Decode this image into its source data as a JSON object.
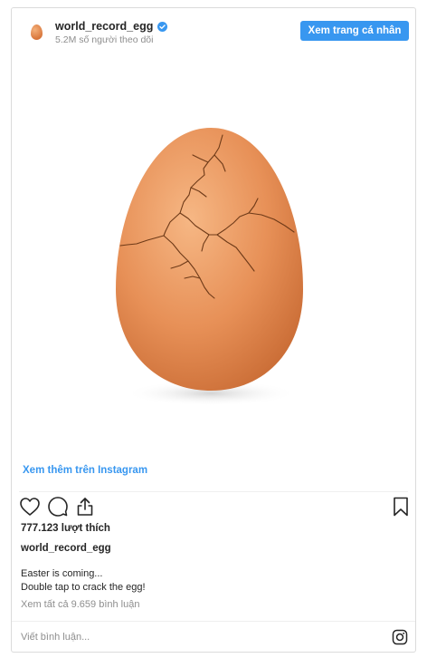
{
  "header": {
    "username": "world_record_egg",
    "followers": "5.2M số người theo dõi",
    "view_profile_label": "Xem trang cá nhân",
    "verified_icon": "verified-badge-icon",
    "accent": "#3897f0"
  },
  "post": {
    "view_more_label": "Xem thêm trên Instagram",
    "likes": "777.123 lượt thích",
    "caption_user": "world_record_egg",
    "caption_lines": [
      "Easter is coming...",
      "Double tap to crack the egg!"
    ],
    "comments_link": "Xem tất cả 9.659 bình luận",
    "comment_placeholder": "Viết bình luận..."
  },
  "icons": {
    "like": "heart-icon",
    "comment": "comment-icon",
    "share": "share-icon",
    "save": "bookmark-icon",
    "instagram": "instagram-logo-icon"
  }
}
